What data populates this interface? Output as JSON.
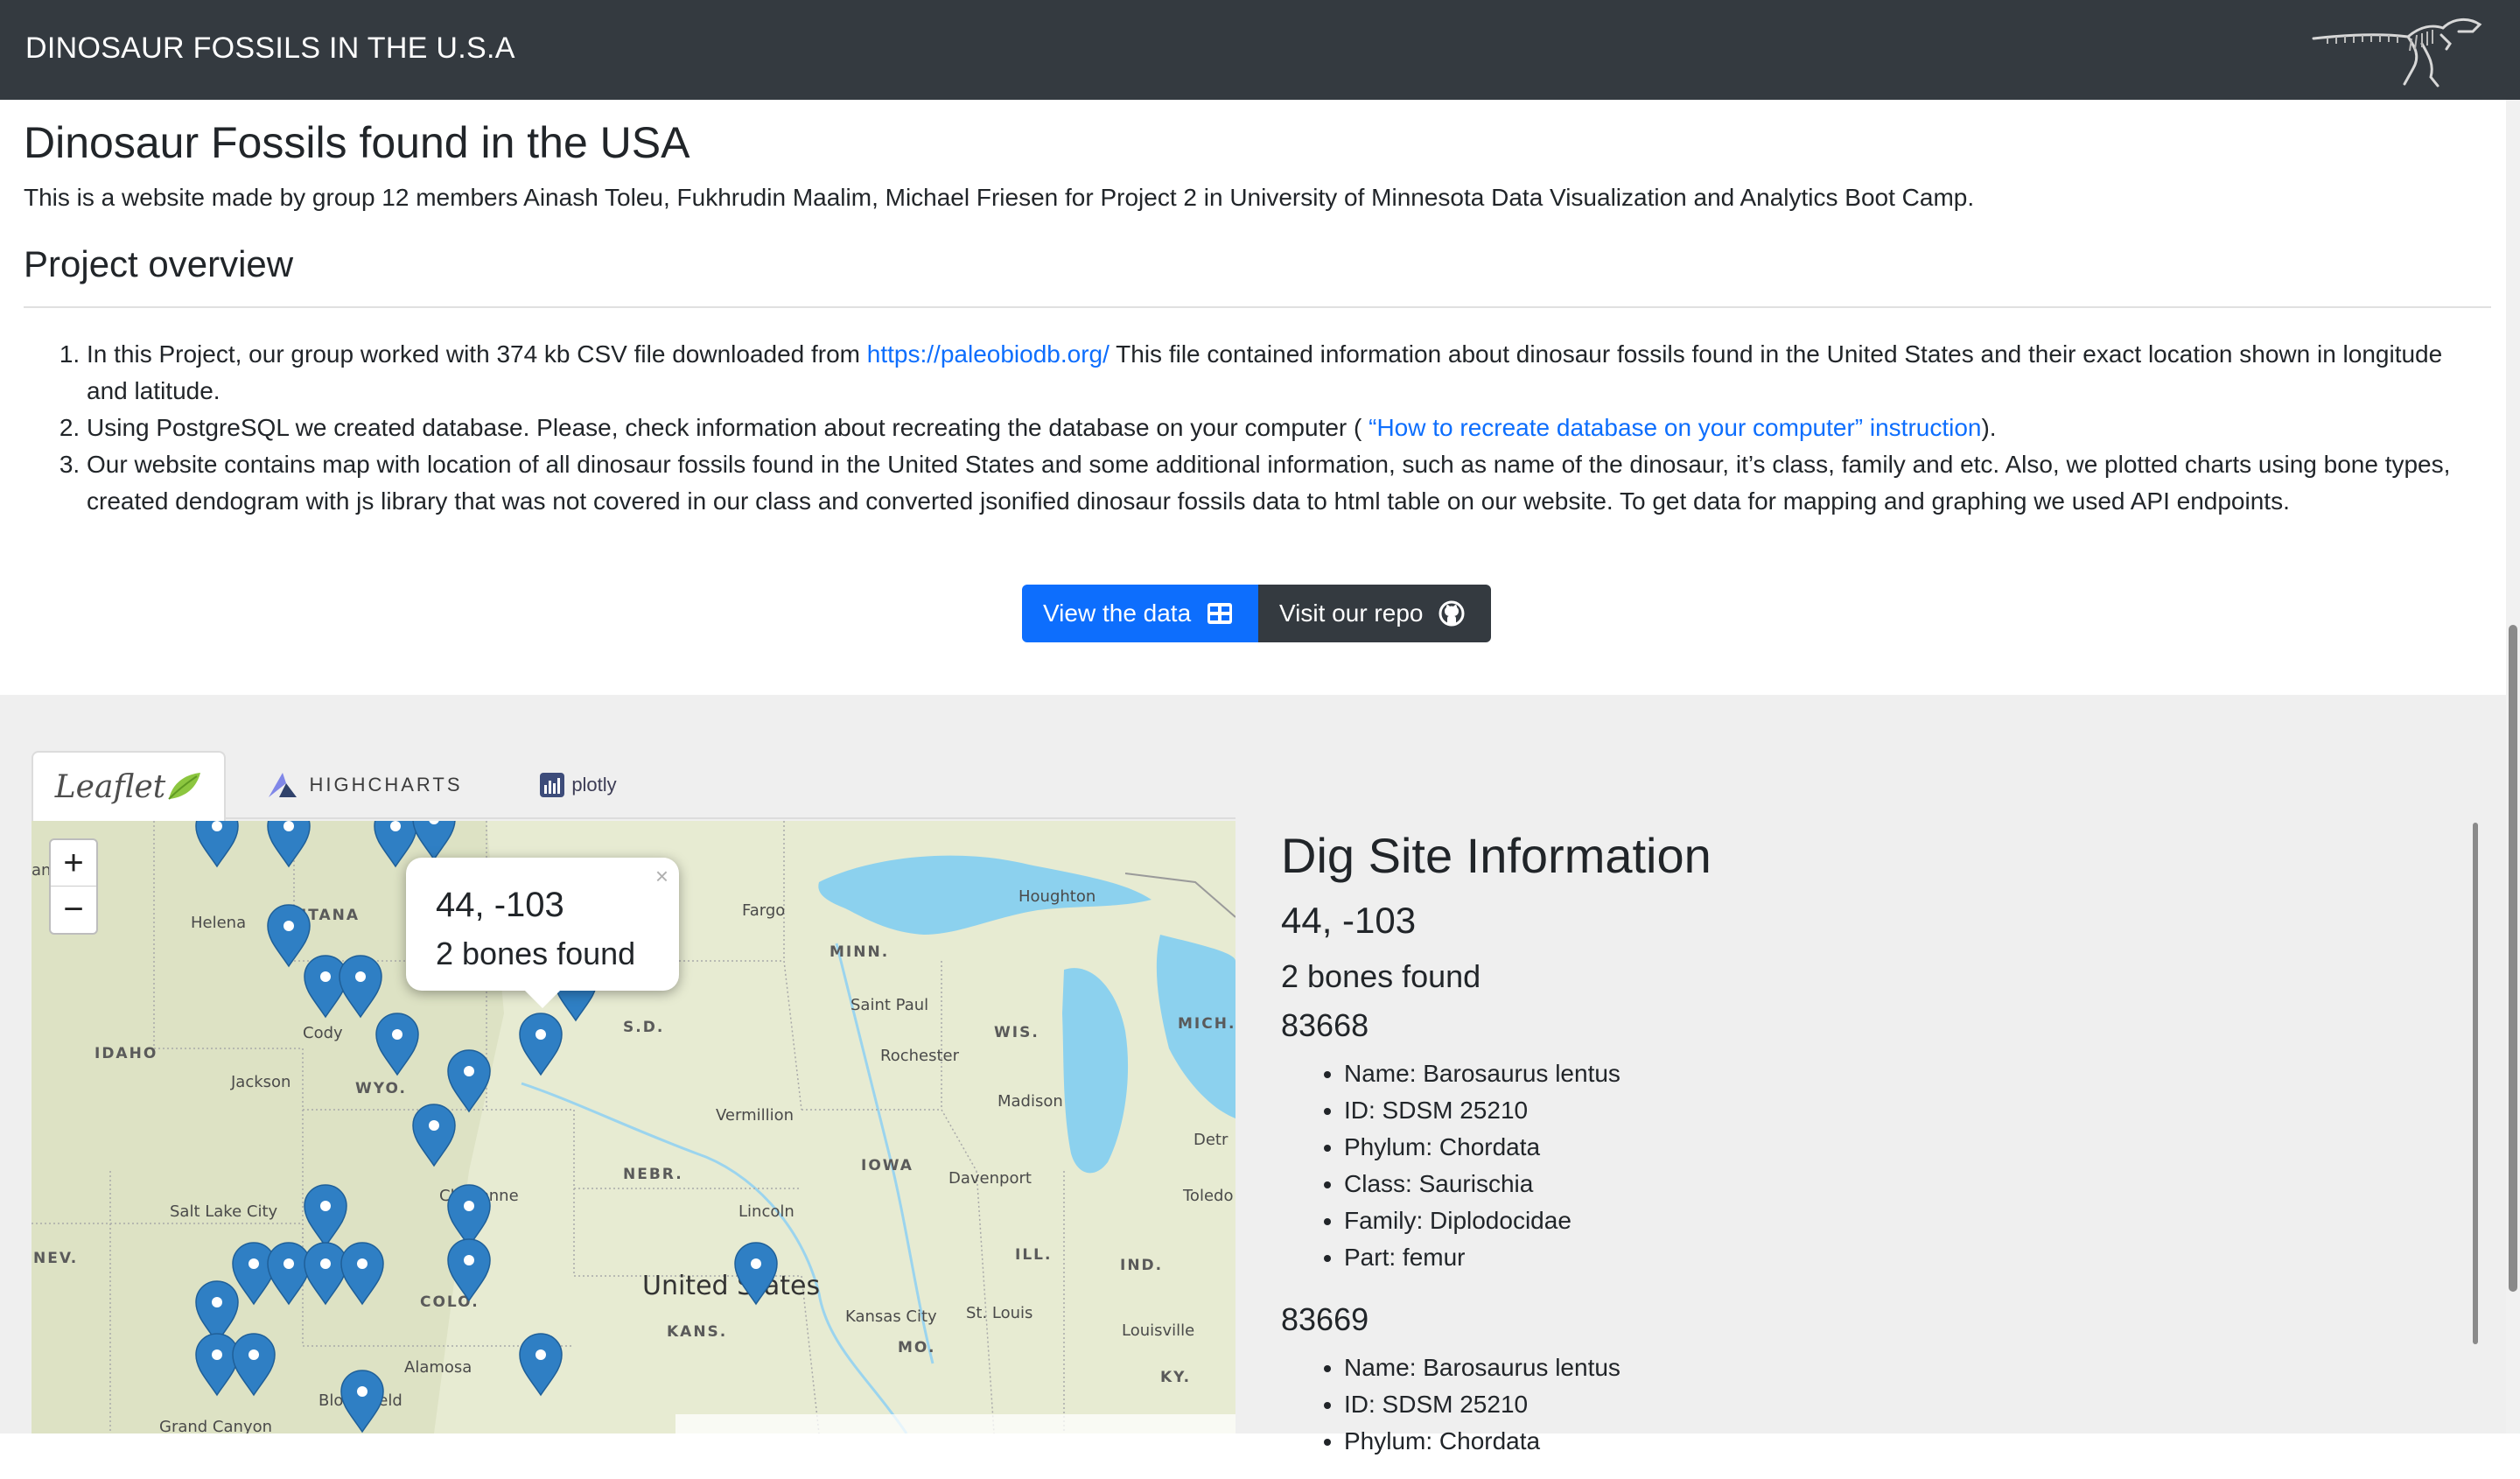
{
  "navbar": {
    "brand": "DINOSAUR FOSSILS IN THE U.S.A",
    "logo_icon": "trex-skeleton-icon"
  },
  "intro": {
    "title": "Dinosaur Fossils found in the USA",
    "subtitle": "This is a website made by group 12 members Ainash Toleu, Fukhrudin Maalim, Michael Friesen for Project 2 in University of Minnesota Data Visualization and Analytics Boot Camp.",
    "overview_heading": "Project overview",
    "steps": [
      {
        "before": "In this Project, our group worked with 374 kb CSV file downloaded from ",
        "link": "https://paleobiodb.org/",
        "after": " This file contained information about dinosaur fossils found in the United States and their exact location shown in longitude and latitude."
      },
      {
        "before": "Using PostgreSQL we created database. Please, check information about recreating the database on your computer ( ",
        "link": "“How to recreate database on your computer” instruction",
        "after": ")."
      },
      {
        "before": "Our website contains map with location of all dinosaur fossils found in the United States and some additional information, such as name of the dinosaur, it’s class, family and etc. Also, we plotted charts using bone types, created dendogram with js library that was not covered in our class and converted jsonified dinosaur fossils data to html table on our website. To get data for mapping and graphing we used API endpoints.",
        "link": "",
        "after": ""
      }
    ],
    "buttons": {
      "view_data": "View the data",
      "visit_repo": "Visit our repo"
    }
  },
  "tabs": {
    "leaflet": "Leaflet",
    "highcharts": "HIGHCHARTS",
    "plotly": "plotly"
  },
  "map": {
    "zoom_in": "+",
    "zoom_out": "−",
    "popup": {
      "coords": "44, -103",
      "bones": "2 bones found",
      "close": "×"
    },
    "labels": {
      "montana": "NTANA",
      "helena": "Helena",
      "idaho": "IDAHO",
      "cody": "Cody",
      "jackson": "Jackson",
      "wyo": "WYO.",
      "sdak": "S.D.",
      "fargo": "Fargo",
      "minn": "MINN.",
      "saint_paul": "Saint Paul",
      "rochester": "Rochester",
      "houghton": "Houghton",
      "wis": "WIS.",
      "mich": "MICH.",
      "madison": "Madison",
      "detroit": "Detr",
      "vermillion": "Vermillion",
      "iowa": "IOWA",
      "davenport": "Davenport",
      "toledo": "Toledo",
      "nebr": "NEBR.",
      "lincoln": "Lincoln",
      "salt_lake": "Salt Lake City",
      "cheyenne": "Cheyenne",
      "nev": "NEV.",
      "colo": "COLO.",
      "ill": "ILL.",
      "ind": "IND.",
      "united_states": "United States",
      "kansas_city": "Kansas City",
      "st_louis": "St. Louis",
      "kans": "KANS.",
      "mo": "MO.",
      "louisville": "Louisville",
      "alamosa": "Alamosa",
      "ky": "KY.",
      "bloomfield": "Bloomfield",
      "grand_canyon": "Grand Canyon",
      "an": "an"
    }
  },
  "info": {
    "title": "Dig Site Information",
    "coords": "44, -103",
    "count": "2 bones found",
    "bones": [
      {
        "id": "83668",
        "props": [
          "Name: Barosaurus lentus",
          "ID: SDSM 25210",
          "Phylum: Chordata",
          "Class: Saurischia",
          "Family: Diplodocidae",
          "Part: femur"
        ]
      },
      {
        "id": "83669",
        "props": [
          "Name: Barosaurus lentus",
          "ID: SDSM 25210",
          "Phylum: Chordata"
        ]
      }
    ]
  },
  "colors": {
    "navbar": "#343a40",
    "primary": "#0d6efd",
    "marker": "#2f7fc4",
    "water": "#8cd1ee"
  }
}
